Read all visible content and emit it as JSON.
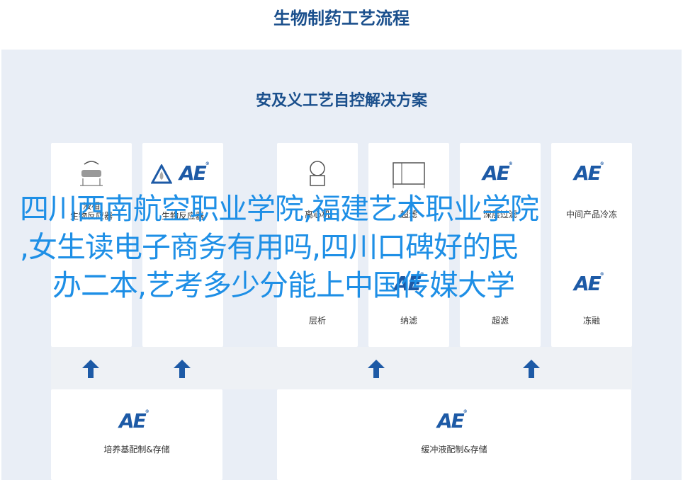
{
  "header": {
    "title": "生物制药工艺流程"
  },
  "panel": {
    "title": "安及义工艺自控解决方案",
    "cards_top": [
      {
        "label": "液相\n生物反应器",
        "icon": "bioreactor-icon"
      },
      {
        "label": "生物反应器",
        "icon": "ae-logo"
      },
      {
        "label": "离心机",
        "icon": "centrifuge-icon"
      },
      {
        "label": "超滤",
        "icon": "filter-skid-icon"
      },
      {
        "label": "深层过滤",
        "icon": "ae-logo"
      },
      {
        "label": "中间产品冷冻",
        "icon": "ae-logo"
      }
    ],
    "cards_mid": [
      {
        "label": "层析"
      },
      {
        "label": "纳滤"
      },
      {
        "label": "超滤"
      },
      {
        "label": "冻融"
      }
    ],
    "cards_bottom": [
      {
        "label": "培养基配制&存储"
      },
      {
        "label": "缓冲液配制&存储"
      }
    ],
    "logo_text": "AE",
    "logo_reg": "®"
  },
  "overlay": {
    "line1": "四川西南航空职业学院,福建艺术职业学院",
    "line2": ",女生读电子商务有用吗,四川口碑好的民",
    "line3": "办二本,艺考多少分能上中国传媒大学"
  },
  "colors": {
    "brand": "#1d5aa6",
    "overlay": "#1e8fe6",
    "title": "#1a4f8c"
  }
}
